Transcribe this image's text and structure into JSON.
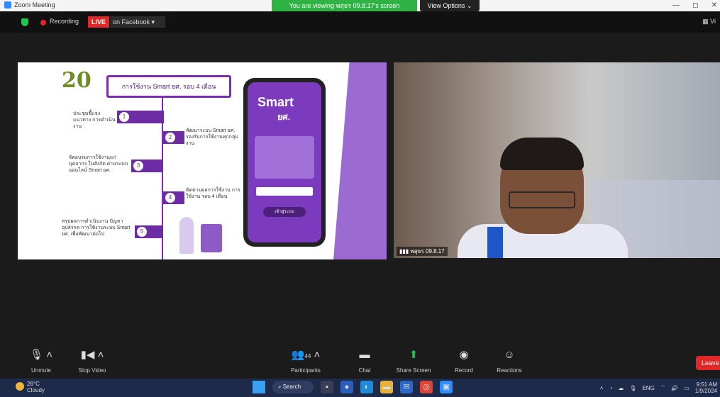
{
  "window": {
    "title": "Zoom Meeting",
    "viewing_banner": "You are viewing พสุธร 09.8.17's screen",
    "view_options": "View Options ⌄",
    "controls": [
      "—",
      "◻",
      "✕"
    ]
  },
  "topbar": {
    "recording": "Recording",
    "live": "LIVE",
    "on_platform": "on Facebook ▾",
    "view_icon": "▦ Vi"
  },
  "slide": {
    "badge": "20",
    "title": "การใช้งาน Smart ยศ. รอบ 4 เดือน",
    "steps": [
      {
        "num": "1",
        "text": "ประชุมชี้แจงแนวทาง การดำเนินงาน"
      },
      {
        "num": "2",
        "text": "พัฒนาระบบ Smart ยศ. รองรับการใช้งานทุกกลุ่มงาน"
      },
      {
        "num": "3",
        "text": "จัดอบรมการใช้งานแก่บุคลากร ในสังกัด ผ่านระบบออนไลน์ Smart ยศ."
      },
      {
        "num": "4",
        "text": "ติดตามผลการใช้งาน การใช้งาน รอบ 4 เดือน"
      },
      {
        "num": "5",
        "text": "สรุปผลการดำเนินงาน ปัญหาอุปสรรค การใช้งานระบบ Smart ยศ. เพื่อพัฒนาต่อไป"
      }
    ],
    "phone": {
      "brand": "Smart",
      "brand_sub": "ยศ.",
      "button": "เข้าสู่ระบบ"
    }
  },
  "video": {
    "participant_name": "พสุธร 09.8.17"
  },
  "toolbar": {
    "unmute": "Unmute",
    "stop_video": "Stop Video",
    "participants": "Participants",
    "participants_count": "44",
    "chat": "Chat",
    "share_screen": "Share Screen",
    "record": "Record",
    "reactions": "Reactions",
    "leave": "Leave"
  },
  "taskbar": {
    "temp": "26°C",
    "weather": "Cloudy",
    "search": "Search",
    "lang": "ENG",
    "time": "9:51 AM",
    "date": "1/9/2024"
  }
}
